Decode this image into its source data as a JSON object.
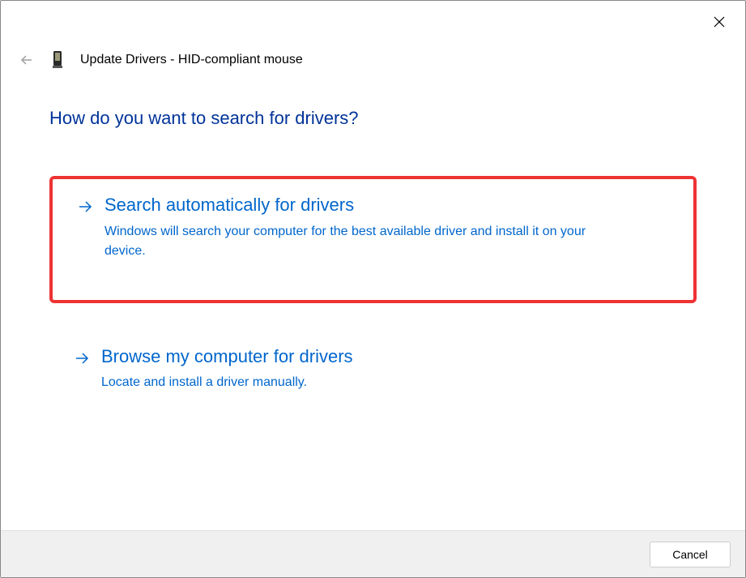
{
  "dialog": {
    "title": "Update Drivers - HID-compliant mouse",
    "heading": "How do you want to search for drivers?"
  },
  "options": [
    {
      "title": "Search automatically for drivers",
      "description": "Windows will search your computer for the best available driver and install it on your device.",
      "highlighted": true
    },
    {
      "title": "Browse my computer for drivers",
      "description": "Locate and install a driver manually.",
      "highlighted": false
    }
  ],
  "footer": {
    "cancel": "Cancel"
  }
}
